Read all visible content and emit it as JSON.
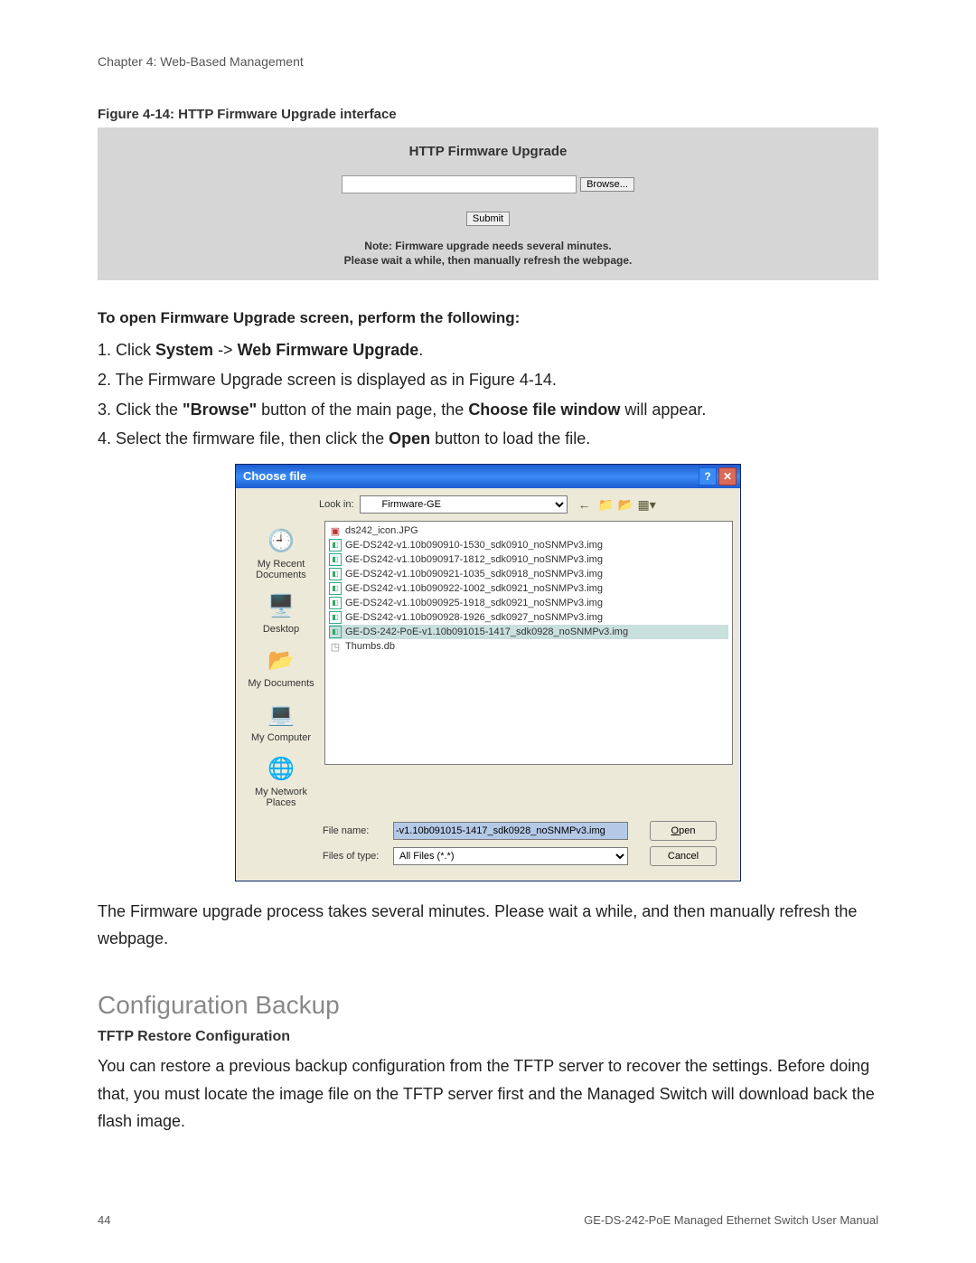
{
  "chapter_header": "Chapter 4: Web-Based Management",
  "figure_caption": "Figure 4-14:  HTTP Firmware Upgrade interface",
  "http_panel": {
    "title": "HTTP Firmware Upgrade",
    "browse_label": "Browse...",
    "submit_label": "Submit",
    "note_line1": "Note: Firmware upgrade needs several minutes.",
    "note_line2": "Please wait a while, then manually refresh the webpage."
  },
  "section_title": "To open Firmware Upgrade screen, perform the following:",
  "steps": {
    "s1_pre": "1. Click ",
    "s1_bold1": "System",
    "s1_mid": " -> ",
    "s1_bold2": "Web Firmware Upgrade",
    "s1_post": ".",
    "s2": "2. The Firmware Upgrade screen is displayed as in Figure 4-14.",
    "s3_pre": "3. Click the ",
    "s3_bold1": "\"Browse\"",
    "s3_mid": " button of the main page, the ",
    "s3_bold2": "Choose file window",
    "s3_post": " will appear.",
    "s4_pre": "4. Select the firmware file, then click the ",
    "s4_bold": "Open",
    "s4_post": " button to load the file."
  },
  "dialog": {
    "title": "Choose file",
    "lookin_label": "Look in:",
    "lookin_value": "Firmware-GE",
    "places": {
      "recent": "My Recent Documents",
      "desktop": "Desktop",
      "mydocs": "My Documents",
      "mycomp": "My Computer",
      "network": "My Network Places"
    },
    "files": [
      "ds242_icon.JPG",
      "GE-DS242-v1.10b090910-1530_sdk0910_noSNMPv3.img",
      "GE-DS242-v1.10b090917-1812_sdk0910_noSNMPv3.img",
      "GE-DS242-v1.10b090921-1035_sdk0918_noSNMPv3.img",
      "GE-DS242-v1.10b090922-1002_sdk0921_noSNMPv3.img",
      "GE-DS242-v1.10b090925-1918_sdk0921_noSNMPv3.img",
      "GE-DS242-v1.10b090928-1926_sdk0927_noSNMPv3.img",
      "GE-DS-242-PoE-v1.10b091015-1417_sdk0928_noSNMPv3.img",
      "Thumbs.db"
    ],
    "filename_label": "File name:",
    "filename_value": "-v1.10b091015-1417_sdk0928_noSNMPv3.img",
    "filetype_label": "Files of type:",
    "filetype_value": "All Files (*.*)",
    "open_label": "Open",
    "cancel_label": "Cancel"
  },
  "post_dialog": "The Firmware upgrade process takes several minutes. Please wait a while, and then manually refresh the webpage.",
  "h2": "Configuration Backup",
  "subhead": "TFTP Restore Configuration",
  "tftp_paragraph": "You can restore a previous backup configuration from the TFTP server to recover the settings. Before doing that, you must locate the image file on the TFTP server first and the Managed Switch will download back the flash image.",
  "footer": {
    "page": "44",
    "doc": "GE-DS-242-PoE Managed Ethernet Switch User Manual"
  }
}
